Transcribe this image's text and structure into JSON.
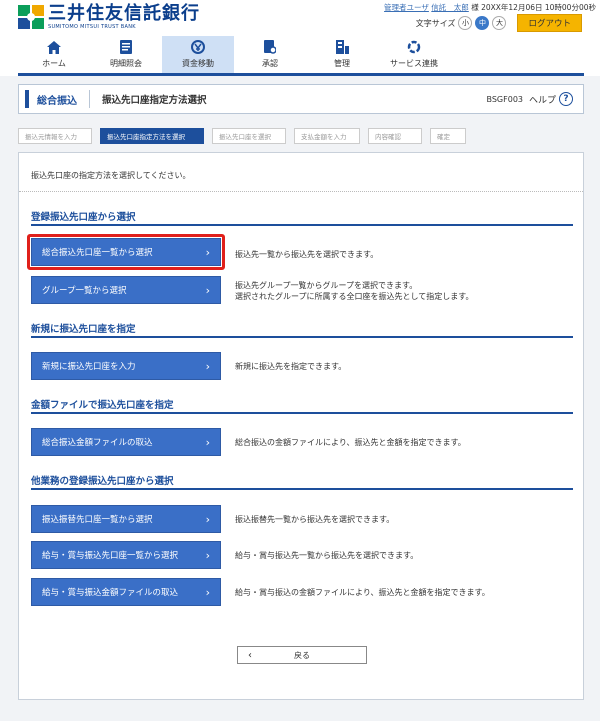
{
  "bank": {
    "name_jp": "三井住友信託銀行",
    "name_en": "SUMITOMO MITSUI TRUST BANK"
  },
  "header": {
    "user_role": "管理者ユーザ",
    "user_name": "信託　太郎",
    "honorific": "様",
    "datetime": "20XX年12月06日 10時00分00秒",
    "font_size_label": "文字サイズ",
    "font_sizes": [
      "小",
      "中",
      "大"
    ],
    "font_size_selected": "中",
    "logout_label": "ログアウト"
  },
  "nav": {
    "items": [
      {
        "label": "ホーム",
        "icon": "home-icon"
      },
      {
        "label": "明細照会",
        "icon": "document-icon"
      },
      {
        "label": "資金移動",
        "icon": "transfer-icon"
      },
      {
        "label": "承認",
        "icon": "approval-icon"
      },
      {
        "label": "管理",
        "icon": "admin-icon"
      },
      {
        "label": "サービス連携",
        "icon": "service-link-icon"
      }
    ],
    "active": "資金移動"
  },
  "title_bar": {
    "main": "総合振込",
    "sub": "振込先口座指定方法選択",
    "screen_code": "BSGF003",
    "help_label": "ヘルプ",
    "help_symbol": "?"
  },
  "steps": [
    "振込元情報を入力",
    "振込先口座指定方法を選択",
    "振込先口座を選択",
    "支払金額を入力",
    "内容確認",
    "確定"
  ],
  "intro": "振込先口座の指定方法を選択してください。",
  "sections": [
    {
      "title": "登録振込先口座から選択",
      "buttons": [
        {
          "label": "総合振込先口座一覧から選択",
          "desc": [
            "振込先一覧から振込先を選択できます。"
          ]
        },
        {
          "label": "グループ一覧から選択",
          "desc": [
            "振込先グループ一覧からグループを選択できます。",
            "選択されたグループに所属する全口座を振込先として指定します。"
          ]
        }
      ]
    },
    {
      "title": "新規に振込先口座を指定",
      "buttons": [
        {
          "label": "新規に振込先口座を入力",
          "desc": [
            "新規に振込先を指定できます。"
          ]
        }
      ]
    },
    {
      "title": "金額ファイルで振込先口座を指定",
      "buttons": [
        {
          "label": "総合振込金額ファイルの取込",
          "desc": [
            "総合振込の金額ファイルにより、振込先と金額を指定できます。"
          ]
        }
      ]
    },
    {
      "title": "他業務の登録振込先口座から選択",
      "buttons": [
        {
          "label": "振込振替先口座一覧から選択",
          "desc": [
            "振込振替先一覧から振込先を選択できます。"
          ]
        },
        {
          "label": "給与・賞与振込先口座一覧から選択",
          "desc": [
            "給与・賞与振込先一覧から振込先を選択できます。"
          ]
        },
        {
          "label": "給与・賞与振込金額ファイルの取込",
          "desc": [
            "給与・賞与振込の金額ファイルにより、振込先と金額を指定できます。"
          ]
        }
      ]
    }
  ],
  "chevron": "›",
  "back": {
    "label": "戻る",
    "chevron": "‹"
  },
  "colors": {
    "primary": "#1d4f9c",
    "button": "#3a6fc7",
    "highlight": "#e0201b",
    "logout": "#f5b400"
  }
}
